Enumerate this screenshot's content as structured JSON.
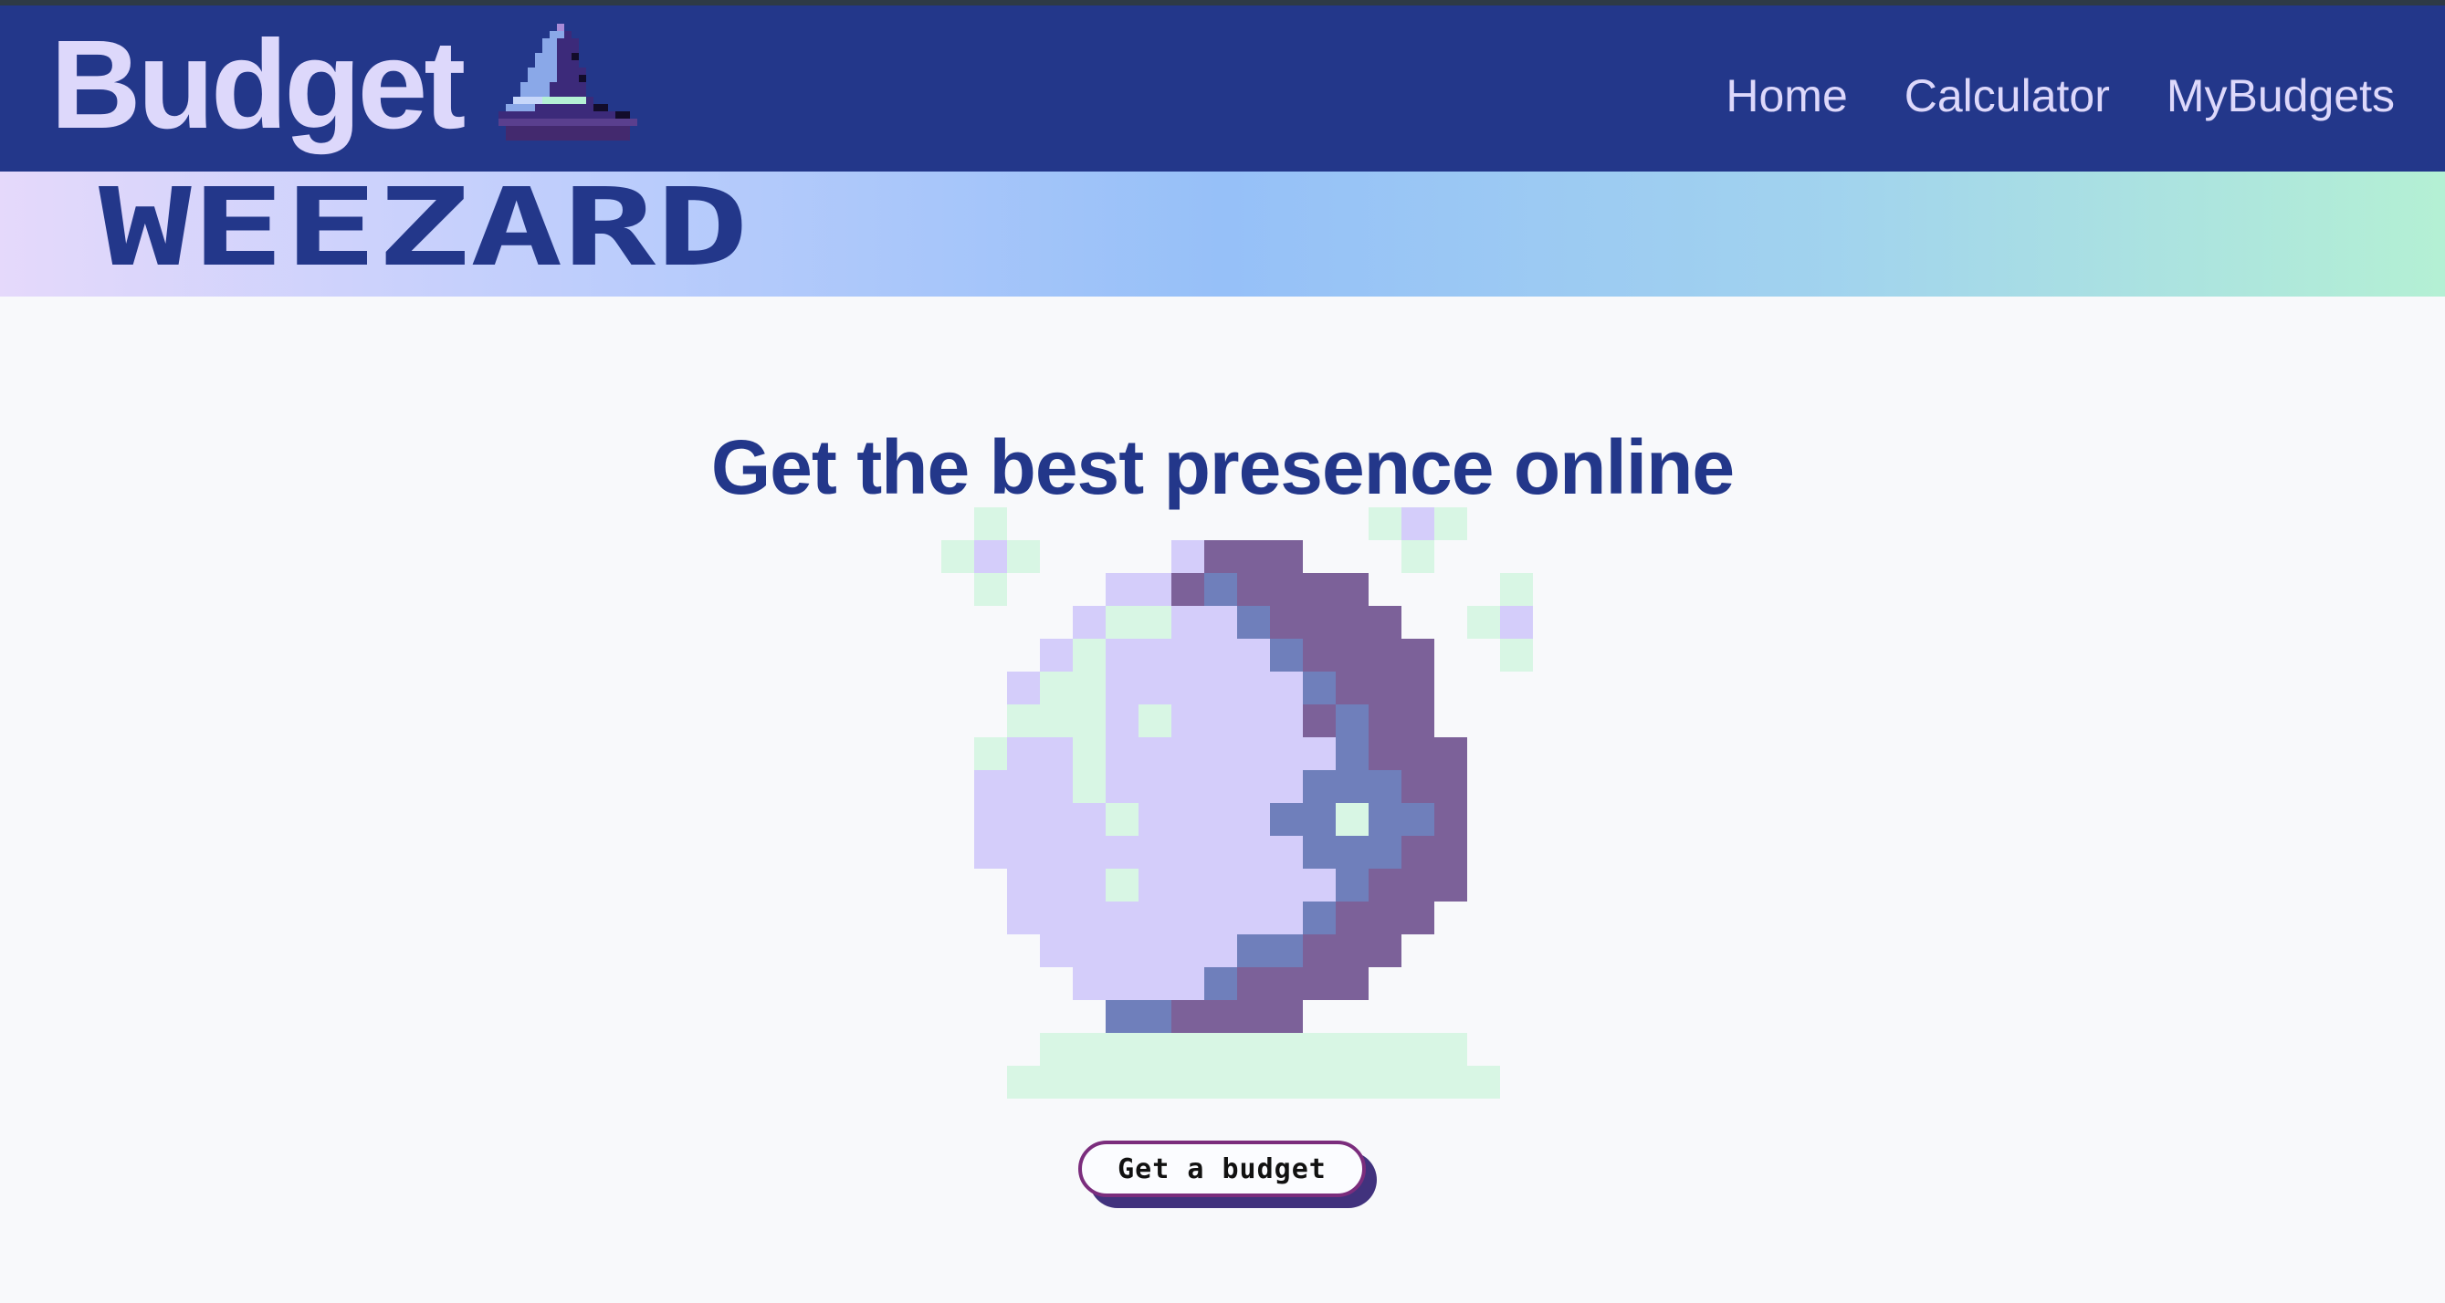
{
  "brand": {
    "title": "Budget",
    "logo_icon": "wizard-hat-icon",
    "subtitle": "WEEZARD"
  },
  "nav": {
    "items": [
      {
        "label": "Home"
      },
      {
        "label": "Calculator"
      },
      {
        "label": "MyBudgets"
      }
    ]
  },
  "hero": {
    "headline": "Get the best presence online",
    "illustration_icon": "crystal-ball-icon",
    "cta_label": "Get a budget"
  },
  "colors": {
    "navbar": "#23378a",
    "brand_text": "#ddd8fb",
    "headline": "#23378a",
    "page_background": "#f8f9fb",
    "banner_gradient": [
      "#e5d9fb",
      "#96c0f8",
      "#b4f0d4"
    ],
    "orb_light": "#d4cdfa",
    "orb_dark": "#7c6199",
    "orb_mid": "#6f7fbb",
    "sparkle": "#d8f6e4",
    "cta_border": "#7b2d7d",
    "cta_shadow": "#41327d"
  }
}
